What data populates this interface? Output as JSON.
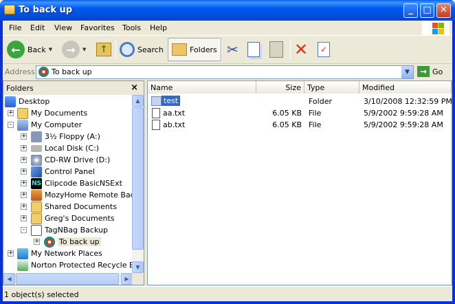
{
  "window": {
    "title": "To back up"
  },
  "menu": [
    "File",
    "Edit",
    "View",
    "Favorites",
    "Tools",
    "Help"
  ],
  "toolbar": {
    "back_label": "Back",
    "search_label": "Search",
    "folders_label": "Folders"
  },
  "address": {
    "label": "Address",
    "value": "To back up",
    "go_label": "Go"
  },
  "folders_pane": {
    "title": "Folders",
    "tree": [
      {
        "label": "Desktop",
        "icon": "desktop-icon",
        "expander": ""
      },
      {
        "label": "My Documents",
        "icon": "documents-folder-icon",
        "expander": "+"
      },
      {
        "label": "My Computer",
        "icon": "computer-icon",
        "expander": "-"
      },
      {
        "label": "3½ Floppy (A:)",
        "icon": "floppy-icon",
        "expander": "+"
      },
      {
        "label": "Local Disk (C:)",
        "icon": "disk-icon",
        "expander": "+"
      },
      {
        "label": "CD-RW Drive (D:)",
        "icon": "cd-drive-icon",
        "expander": "+"
      },
      {
        "label": "Control Panel",
        "icon": "control-panel-icon",
        "expander": "+"
      },
      {
        "label": "Clipcode BasicNSExt",
        "icon": "ns-icon",
        "expander": "+"
      },
      {
        "label": "MozyHome Remote Backup",
        "icon": "mozy-icon",
        "expander": "+"
      },
      {
        "label": "Shared Documents",
        "icon": "folder-icon",
        "expander": "+"
      },
      {
        "label": "Greg's Documents",
        "icon": "folder-icon",
        "expander": "+"
      },
      {
        "label": "TagNBag Backup",
        "icon": "tagnbag-icon",
        "expander": "-"
      },
      {
        "label": "To back up",
        "icon": "backup-disc-icon",
        "expander": "+"
      },
      {
        "label": "My Network Places",
        "icon": "network-icon",
        "expander": "+"
      },
      {
        "label": "Norton Protected Recycle Bin",
        "icon": "recycle-bin-icon",
        "expander": ""
      }
    ]
  },
  "files": {
    "columns": [
      "Name",
      "Size",
      "Type",
      "Modified"
    ],
    "rows": [
      {
        "name": "test",
        "size": "",
        "type": "Folder",
        "modified": "3/10/2008 12:32:59 PM",
        "icon": "folder-icon"
      },
      {
        "name": "aa.txt",
        "size": "6.05 KB",
        "type": "File",
        "modified": "5/9/2002 9:59:28 AM",
        "icon": "text-file-icon"
      },
      {
        "name": "ab.txt",
        "size": "6.05 KB",
        "type": "File",
        "modified": "5/9/2002 9:59:28 AM",
        "icon": "text-file-icon"
      }
    ]
  },
  "status": {
    "text": "1 object(s) selected"
  }
}
